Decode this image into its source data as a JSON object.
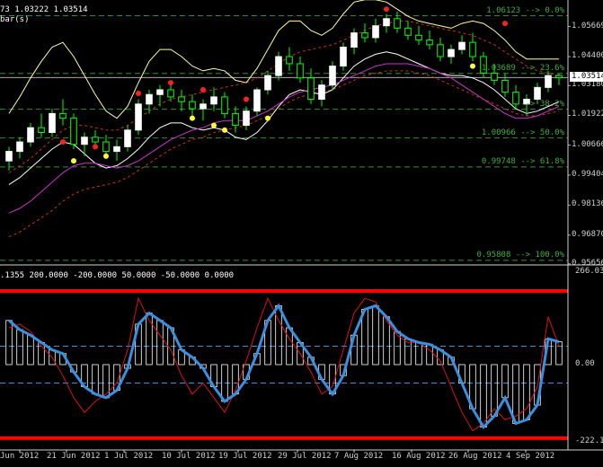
{
  "header": {
    "main_info": "73 1.03222 1.03514",
    "main_info2": "bar(s)",
    "indicator_info": ".1355 200.0000 -200.0000 50.0000 -50.0000 0.0000"
  },
  "price_axis": {
    "labels": [
      "1.05669",
      "1.04400",
      "1.03180",
      "1.01922",
      "1.00666",
      "0.99404",
      "0.98136",
      "0.96870",
      "0.95656"
    ],
    "current": "1.03514"
  },
  "fib_levels": [
    {
      "label": "1.06123 --> 0.0%",
      "value": 1.06123
    },
    {
      "label": "1.03689 --> 23.6%",
      "value": 1.03689
    },
    {
      "label": "--> 38.2%",
      "value": 1.0218
    },
    {
      "label": "1.00966 --> 50.0%",
      "value": 1.00966
    },
    {
      "label": "0.99748 --> 61.8%",
      "value": 0.99748
    },
    {
      "label": "0.95808 --> 100.0%",
      "value": 0.95808
    }
  ],
  "osc_axis": {
    "labels": [
      "266.03",
      "0.00",
      "-222.19"
    ]
  },
  "date_axis": {
    "labels": [
      "Jun 2012",
      "21 Jun 2012",
      "1 Jul 2012",
      "10 Jul 2012",
      "19 Jul 2012",
      "29 Jul 2012",
      "7 Aug 2012",
      "16 Aug 2012",
      "26 Aug 2012",
      "4 Sep 2012"
    ]
  },
  "colors": {
    "bull_candle": "#ffffff",
    "bear_candle": "#00ff00",
    "upper_band": "#ffff99",
    "lower_band": "#ffffff",
    "ma_magenta": "#cc33cc",
    "dashed_red": "#cc3311",
    "fib": "#2f8f2f",
    "dot_red": "#ff2020",
    "dot_yellow": "#ffff33",
    "cci_line": "#3a8fe0",
    "signal_line": "#dd1111",
    "level_line": "#ff0000",
    "hist": "#ffffff"
  },
  "chart_data": [
    {
      "type": "candlestick",
      "ylim": [
        0.9565,
        1.0675
      ],
      "candles": [
        [
          1.0,
          1.006,
          0.996,
          1.004
        ],
        [
          1.004,
          1.01,
          1.001,
          1.008
        ],
        [
          1.008,
          1.016,
          1.006,
          1.014
        ],
        [
          1.014,
          1.02,
          1.01,
          1.012
        ],
        [
          1.012,
          1.022,
          1.01,
          1.02
        ],
        [
          1.02,
          1.026,
          1.015,
          1.018
        ],
        [
          1.018,
          1.02,
          1.005,
          1.007
        ],
        [
          1.007,
          1.012,
          1.002,
          1.01
        ],
        [
          1.01,
          1.013,
          1.005,
          1.008
        ],
        [
          1.008,
          1.011,
          1.002,
          1.004
        ],
        [
          1.004,
          1.009,
          1.0,
          1.006
        ],
        [
          1.006,
          1.015,
          1.004,
          1.013
        ],
        [
          1.013,
          1.026,
          1.011,
          1.024
        ],
        [
          1.024,
          1.03,
          1.02,
          1.028
        ],
        [
          1.028,
          1.032,
          1.023,
          1.03
        ],
        [
          1.03,
          1.034,
          1.025,
          1.027
        ],
        [
          1.027,
          1.03,
          1.021,
          1.025
        ],
        [
          1.025,
          1.028,
          1.019,
          1.022
        ],
        [
          1.022,
          1.026,
          1.017,
          1.024
        ],
        [
          1.024,
          1.031,
          1.021,
          1.027
        ],
        [
          1.027,
          1.029,
          1.018,
          1.02
        ],
        [
          1.02,
          1.023,
          1.012,
          1.015
        ],
        [
          1.015,
          1.023,
          1.013,
          1.021
        ],
        [
          1.021,
          1.031,
          1.019,
          1.03
        ],
        [
          1.03,
          1.038,
          1.028,
          1.036
        ],
        [
          1.036,
          1.046,
          1.034,
          1.044
        ],
        [
          1.044,
          1.048,
          1.038,
          1.041
        ],
        [
          1.041,
          1.044,
          1.033,
          1.035
        ],
        [
          1.035,
          1.039,
          1.024,
          1.026
        ],
        [
          1.026,
          1.034,
          1.023,
          1.032
        ],
        [
          1.032,
          1.042,
          1.03,
          1.04
        ],
        [
          1.04,
          1.05,
          1.038,
          1.048
        ],
        [
          1.048,
          1.056,
          1.045,
          1.054
        ],
        [
          1.054,
          1.058,
          1.05,
          1.052
        ],
        [
          1.052,
          1.06,
          1.05,
          1.057
        ],
        [
          1.057,
          1.062,
          1.054,
          1.06
        ],
        [
          1.06,
          1.063,
          1.054,
          1.056
        ],
        [
          1.056,
          1.059,
          1.051,
          1.053
        ],
        [
          1.053,
          1.057,
          1.049,
          1.051
        ],
        [
          1.051,
          1.055,
          1.047,
          1.049
        ],
        [
          1.049,
          1.052,
          1.042,
          1.044
        ],
        [
          1.044,
          1.049,
          1.041,
          1.047
        ],
        [
          1.047,
          1.053,
          1.045,
          1.05
        ],
        [
          1.05,
          1.054,
          1.042,
          1.044
        ],
        [
          1.044,
          1.046,
          1.035,
          1.037
        ],
        [
          1.037,
          1.041,
          1.032,
          1.034
        ],
        [
          1.034,
          1.037,
          1.027,
          1.029
        ],
        [
          1.029,
          1.032,
          1.022,
          1.024
        ],
        [
          1.024,
          1.028,
          1.019,
          1.026
        ],
        [
          1.026,
          1.033,
          1.024,
          1.031
        ],
        [
          1.031,
          1.038,
          1.029,
          1.036
        ],
        [
          1.036,
          1.037,
          1.032,
          1.0351
        ]
      ],
      "upper_band": [
        1.02,
        1.027,
        1.035,
        1.042,
        1.048,
        1.05,
        1.044,
        1.036,
        1.028,
        1.021,
        1.018,
        1.023,
        1.033,
        1.042,
        1.047,
        1.047,
        1.044,
        1.04,
        1.038,
        1.039,
        1.038,
        1.034,
        1.033,
        1.039,
        1.047,
        1.055,
        1.059,
        1.059,
        1.055,
        1.053,
        1.056,
        1.062,
        1.067,
        1.068,
        1.068,
        1.067,
        1.064,
        1.061,
        1.059,
        1.058,
        1.057,
        1.056,
        1.058,
        1.059,
        1.058,
        1.055,
        1.051,
        1.046,
        1.043,
        1.043,
        1.043,
        1.043
      ],
      "lower_band": [
        0.99,
        0.993,
        0.997,
        1.001,
        1.005,
        1.008,
        1.007,
        1.003,
        0.999,
        0.997,
        0.998,
        1.001,
        1.005,
        1.01,
        1.014,
        1.016,
        1.016,
        1.014,
        1.013,
        1.014,
        1.013,
        1.01,
        1.009,
        1.012,
        1.017,
        1.023,
        1.028,
        1.03,
        1.029,
        1.028,
        1.03,
        1.035,
        1.04,
        1.043,
        1.045,
        1.046,
        1.045,
        1.043,
        1.041,
        1.039,
        1.037,
        1.036,
        1.036,
        1.035,
        1.033,
        1.03,
        1.026,
        1.022,
        1.02,
        1.021,
        1.023,
        1.025
      ],
      "ma_magenta": [
        0.978,
        0.98,
        0.983,
        0.987,
        0.991,
        0.995,
        0.998,
        0.999,
        0.999,
        0.998,
        0.997,
        0.998,
        1.0,
        1.003,
        1.006,
        1.009,
        1.011,
        1.013,
        1.014,
        1.016,
        1.017,
        1.017,
        1.017,
        1.019,
        1.021,
        1.024,
        1.027,
        1.029,
        1.03,
        1.031,
        1.032,
        1.034,
        1.036,
        1.038,
        1.04,
        1.041,
        1.041,
        1.041,
        1.04,
        1.039,
        1.037,
        1.035,
        1.032,
        1.029,
        1.026,
        1.023,
        1.02,
        1.018,
        1.018,
        1.019,
        1.021,
        1.023
      ],
      "dashed_upper": [
        0.995,
        0.998,
        1.001,
        1.005,
        1.009,
        1.013,
        1.015,
        1.015,
        1.014,
        1.013,
        1.013,
        1.015,
        1.018,
        1.021,
        1.024,
        1.026,
        1.027,
        1.028,
        1.029,
        1.03,
        1.031,
        1.032,
        1.033,
        1.035,
        1.038,
        1.041,
        1.044,
        1.046,
        1.047,
        1.048,
        1.049,
        1.051,
        1.053,
        1.055,
        1.057,
        1.058,
        1.059,
        1.059,
        1.058,
        1.057,
        1.056,
        1.055,
        1.054,
        1.053,
        1.051,
        1.049,
        1.046,
        1.043,
        1.04,
        1.038,
        1.037,
        1.036
      ],
      "dashed_lower": [
        0.968,
        0.97,
        0.973,
        0.976,
        0.979,
        0.983,
        0.986,
        0.988,
        0.989,
        0.99,
        0.991,
        0.993,
        0.996,
        0.999,
        1.002,
        1.005,
        1.007,
        1.009,
        1.01,
        1.012,
        1.013,
        1.014,
        1.015,
        1.017,
        1.019,
        1.022,
        1.025,
        1.027,
        1.028,
        1.029,
        1.03,
        1.032,
        1.034,
        1.036,
        1.037,
        1.038,
        1.038,
        1.038,
        1.037,
        1.036,
        1.034,
        1.032,
        1.03,
        1.028,
        1.026,
        1.024,
        1.022,
        1.02,
        1.019,
        1.019,
        1.02,
        1.021
      ],
      "red_dots": [
        [
          5,
          1.008
        ],
        [
          8,
          1.006
        ],
        [
          12,
          1.0285
        ],
        [
          15,
          1.033
        ],
        [
          18,
          1.03
        ],
        [
          22,
          1.026
        ],
        [
          35,
          1.064
        ],
        [
          46,
          1.058
        ]
      ],
      "yellow_dots": [
        [
          6,
          1.0
        ],
        [
          9,
          1.002
        ],
        [
          17,
          1.018
        ],
        [
          19,
          1.015
        ],
        [
          20,
          1.013
        ],
        [
          24,
          1.018
        ],
        [
          43,
          1.04
        ]
      ]
    },
    {
      "type": "oscillator",
      "ylim": [
        -222.19,
        266.03
      ],
      "levels": [
        200,
        -200,
        50,
        -50,
        0
      ],
      "cci": [
        120,
        95,
        80,
        60,
        40,
        30,
        -20,
        -60,
        -80,
        -90,
        -70,
        -10,
        110,
        140,
        120,
        100,
        40,
        20,
        -10,
        -60,
        -100,
        -80,
        -40,
        30,
        120,
        160,
        100,
        60,
        20,
        -40,
        -80,
        -30,
        80,
        150,
        160,
        130,
        90,
        70,
        60,
        55,
        40,
        20,
        -50,
        -120,
        -170,
        -140,
        -90,
        -160,
        -150,
        -110,
        70,
        62
      ],
      "signal": [
        100,
        110,
        90,
        50,
        20,
        -30,
        -90,
        -130,
        -100,
        -80,
        -50,
        40,
        180,
        120,
        80,
        40,
        -30,
        -80,
        -50,
        -90,
        -130,
        -70,
        10,
        100,
        180,
        120,
        70,
        30,
        -20,
        -80,
        -60,
        40,
        140,
        180,
        170,
        120,
        80,
        60,
        60,
        40,
        10,
        -60,
        -130,
        -180,
        -160,
        -120,
        -150,
        -140,
        -120,
        -60,
        130,
        50
      ]
    }
  ]
}
